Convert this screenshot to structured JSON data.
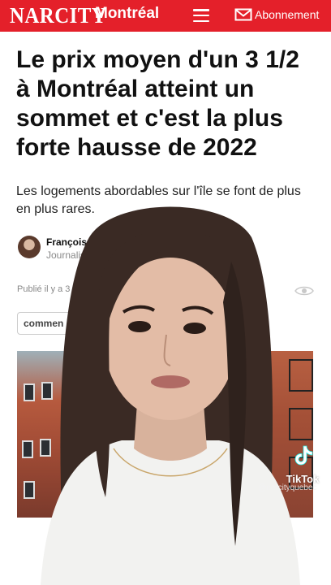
{
  "header": {
    "logo": "NARCITY",
    "city": "Montréal",
    "subscribe_label": "Abonnement",
    "menu_icon": "hamburger-menu-icon",
    "mail_icon": "envelope-icon",
    "brand_color": "#e4202a"
  },
  "article": {
    "headline": "Le prix moyen d'un 3 1/2 à Montréal atteint un sommet et c'est la plus forte hausse de 2022",
    "subtitle": "Les logements abordables sur l'île se font de plus en plus rares.",
    "author_name": "Françoise G",
    "author_role": "Journalist",
    "date_text": "Publié il y a 3",
    "comment_label": "commen",
    "share_icon": "share-icon"
  },
  "overlay": {
    "tiktok_label": "TikTok",
    "tiktok_user": "@narcityquebec",
    "tiktok_icon": "tiktok-note-icon"
  }
}
